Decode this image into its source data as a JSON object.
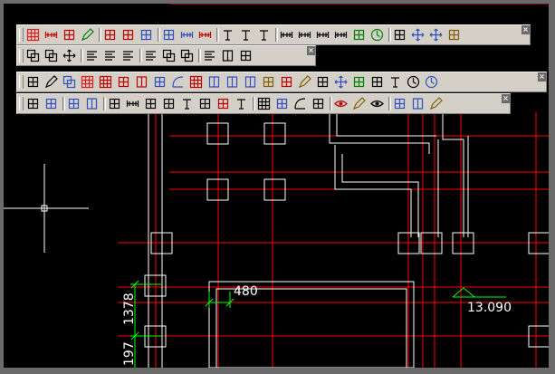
{
  "window": {
    "title": ""
  },
  "toolbars": [
    {
      "id": "tb1",
      "close": "×",
      "buttons": [
        {
          "icon": "grid-axis-icon",
          "color": "#e02020"
        },
        {
          "icon": "dimension-axis-icon",
          "color": "#c00000"
        },
        {
          "icon": "axis-label-icon",
          "color": "#c00000"
        },
        {
          "icon": "axis-edit-icon",
          "color": "#008000"
        },
        {
          "sep": true
        },
        {
          "icon": "floor-line-icon",
          "color": "#c00000"
        },
        {
          "icon": "level-icon",
          "color": "#c00000"
        },
        {
          "icon": "elevation-icon",
          "color": "#3050c0"
        },
        {
          "sep": true
        },
        {
          "icon": "mirror-icon",
          "color": "#3050c0"
        },
        {
          "icon": "arc-dim-icon",
          "color": "#3050c0"
        },
        {
          "icon": "point-dim-icon",
          "color": "#c00000"
        },
        {
          "sep": true
        },
        {
          "icon": "text-style-icon",
          "color": "#000"
        },
        {
          "icon": "text-icon",
          "color": "#000"
        },
        {
          "icon": "text-edit-icon",
          "color": "#000"
        },
        {
          "sep": true
        },
        {
          "icon": "chain-dim-icon",
          "color": "#000"
        },
        {
          "icon": "linear-dim-icon",
          "color": "#000"
        },
        {
          "icon": "continuous-dim-icon",
          "color": "#000"
        },
        {
          "icon": "angle-dim-icon",
          "color": "#000"
        },
        {
          "icon": "slope-icon",
          "color": "#008000"
        },
        {
          "icon": "rotate-icon",
          "color": "#008000"
        },
        {
          "sep": true
        },
        {
          "icon": "link-icon",
          "color": "#000"
        },
        {
          "icon": "move-icon",
          "color": "#3050c0"
        },
        {
          "icon": "pan-icon",
          "color": "#3050c0"
        },
        {
          "icon": "clipboard-icon",
          "color": "#806000"
        }
      ]
    },
    {
      "id": "tb2",
      "close": "×",
      "buttons": [
        {
          "icon": "copy-layer-icon",
          "color": "#000"
        },
        {
          "icon": "layer-stack-icon",
          "color": "#000"
        },
        {
          "icon": "layer-move-icon",
          "color": "#000"
        },
        {
          "sep": true
        },
        {
          "icon": "align-left-icon",
          "color": "#000"
        },
        {
          "icon": "align-center-icon",
          "color": "#000"
        },
        {
          "icon": "align-right-icon",
          "color": "#000"
        },
        {
          "sep": true
        },
        {
          "icon": "distribute-icon",
          "color": "#000"
        },
        {
          "icon": "stack-icon",
          "color": "#000"
        },
        {
          "icon": "group-icon",
          "color": "#000"
        },
        {
          "sep": true
        },
        {
          "icon": "list-icon",
          "color": "#000"
        },
        {
          "icon": "columns-icon",
          "color": "#000"
        },
        {
          "icon": "parallel-icon",
          "color": "#000"
        }
      ]
    },
    {
      "id": "tb3",
      "close": "×",
      "buttons": [
        {
          "icon": "properties-icon",
          "color": "#000"
        },
        {
          "icon": "edit-icon",
          "color": "#000"
        },
        {
          "icon": "layers-icon",
          "color": "#3050c0"
        },
        {
          "icon": "grid-icon",
          "color": "#e02020"
        },
        {
          "icon": "axis-grid-icon",
          "color": "#c00000"
        },
        {
          "icon": "cross-axis-icon",
          "color": "#c00000"
        },
        {
          "icon": "column-icon",
          "color": "#c00000"
        },
        {
          "icon": "beam-icon",
          "color": "#3050c0"
        },
        {
          "icon": "arc-icon",
          "color": "#3050c0"
        },
        {
          "icon": "table-icon",
          "color": "#c00000"
        },
        {
          "icon": "window-icon",
          "color": "#3050c0"
        },
        {
          "icon": "door-icon",
          "color": "#3050c0"
        },
        {
          "icon": "door-open-icon",
          "color": "#3050c0"
        },
        {
          "icon": "mail-icon",
          "color": "#806000"
        },
        {
          "icon": "print-icon",
          "color": "#c00000"
        },
        {
          "icon": "brush-icon",
          "color": "#806000"
        },
        {
          "icon": "book-icon",
          "color": "#000"
        },
        {
          "icon": "panel-icon",
          "color": "#3050c0"
        },
        {
          "icon": "section-icon",
          "color": "#008000"
        },
        {
          "icon": "stairs-icon",
          "color": "#000"
        },
        {
          "icon": "text-a-icon",
          "color": "#000"
        },
        {
          "icon": "compass-icon",
          "color": "#000"
        },
        {
          "icon": "help-icon",
          "color": "#3050c0"
        }
      ]
    },
    {
      "id": "tb4",
      "close": "×",
      "buttons": [
        {
          "icon": "open-doc-icon",
          "color": "#000"
        },
        {
          "icon": "zoom-doc-icon",
          "color": "#3050c0"
        },
        {
          "sep": true
        },
        {
          "icon": "split-icon",
          "color": "#3050c0"
        },
        {
          "icon": "frame-icon",
          "color": "#3050c0"
        },
        {
          "sep": true
        },
        {
          "icon": "pipe-icon",
          "color": "#000"
        },
        {
          "icon": "measure-icon",
          "color": "#000"
        },
        {
          "icon": "angle-icon",
          "color": "#000"
        },
        {
          "icon": "stair-rail-icon",
          "color": "#000"
        },
        {
          "icon": "text-a-icon",
          "color": "#000"
        },
        {
          "icon": "export-icon",
          "color": "#000"
        },
        {
          "icon": "number-icon",
          "color": "#c00000"
        },
        {
          "icon": "abc-icon",
          "color": "#000"
        },
        {
          "sep": true
        },
        {
          "icon": "dots-grid-icon",
          "color": "#000"
        },
        {
          "icon": "wave-icon",
          "color": "#3050c0"
        },
        {
          "icon": "arch-icon",
          "color": "#000"
        },
        {
          "icon": "house-icon",
          "color": "#000"
        },
        {
          "sep": true
        },
        {
          "icon": "eye-red-icon",
          "color": "#c00000"
        },
        {
          "icon": "pencil-icon",
          "color": "#806000"
        },
        {
          "icon": "eye-icon",
          "color": "#000"
        },
        {
          "sep": true
        },
        {
          "icon": "tiles-icon",
          "color": "#3050c0"
        },
        {
          "icon": "frame-dot-icon",
          "color": "#3050c0"
        },
        {
          "icon": "broom-icon",
          "color": "#806000"
        }
      ]
    }
  ],
  "drawing": {
    "dims": {
      "d480": "480",
      "d1378": "1378",
      "d197": "197"
    },
    "elevation": "13.090"
  },
  "colors": {
    "axis": "#ff0000",
    "wall": "#ffffff",
    "dim": "#00ff00",
    "cursor": "#ffffff"
  }
}
